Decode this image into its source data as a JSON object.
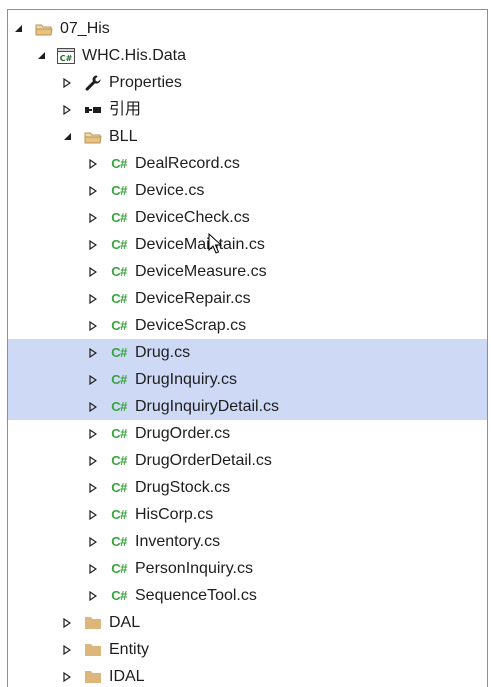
{
  "tree": {
    "root": {
      "label": "07_His",
      "icon": "solution-folder-icon"
    },
    "project": {
      "label": "WHC.His.Data",
      "icon": "csharp-project-icon"
    },
    "properties": {
      "label": "Properties",
      "icon": "wrench-icon"
    },
    "references": {
      "label": "引用",
      "icon": "references-icon"
    },
    "bll": {
      "label": "BLL",
      "icon": "open-folder-icon"
    },
    "files": [
      {
        "label": "DealRecord.cs",
        "selected": false
      },
      {
        "label": "Device.cs",
        "selected": false
      },
      {
        "label": "DeviceCheck.cs",
        "selected": false
      },
      {
        "label": "DeviceMaintain.cs",
        "selected": false
      },
      {
        "label": "DeviceMeasure.cs",
        "selected": false
      },
      {
        "label": "DeviceRepair.cs",
        "selected": false
      },
      {
        "label": "DeviceScrap.cs",
        "selected": false
      },
      {
        "label": "Drug.cs",
        "selected": true
      },
      {
        "label": "DrugInquiry.cs",
        "selected": true
      },
      {
        "label": "DrugInquiryDetail.cs",
        "selected": true
      },
      {
        "label": "DrugOrder.cs",
        "selected": false
      },
      {
        "label": "DrugOrderDetail.cs",
        "selected": false
      },
      {
        "label": "DrugStock.cs",
        "selected": false
      },
      {
        "label": "HisCorp.cs",
        "selected": false
      },
      {
        "label": "Inventory.cs",
        "selected": false
      },
      {
        "label": "PersonInquiry.cs",
        "selected": false
      },
      {
        "label": "SequenceTool.cs",
        "selected": false
      }
    ],
    "folders": [
      {
        "label": "DAL"
      },
      {
        "label": "Entity"
      },
      {
        "label": "IDAL"
      }
    ],
    "file_icon_text": "C#",
    "colors": {
      "selection": "#cdd9f5",
      "csharp": "#39a33e",
      "folder": "#dcb67a"
    }
  }
}
